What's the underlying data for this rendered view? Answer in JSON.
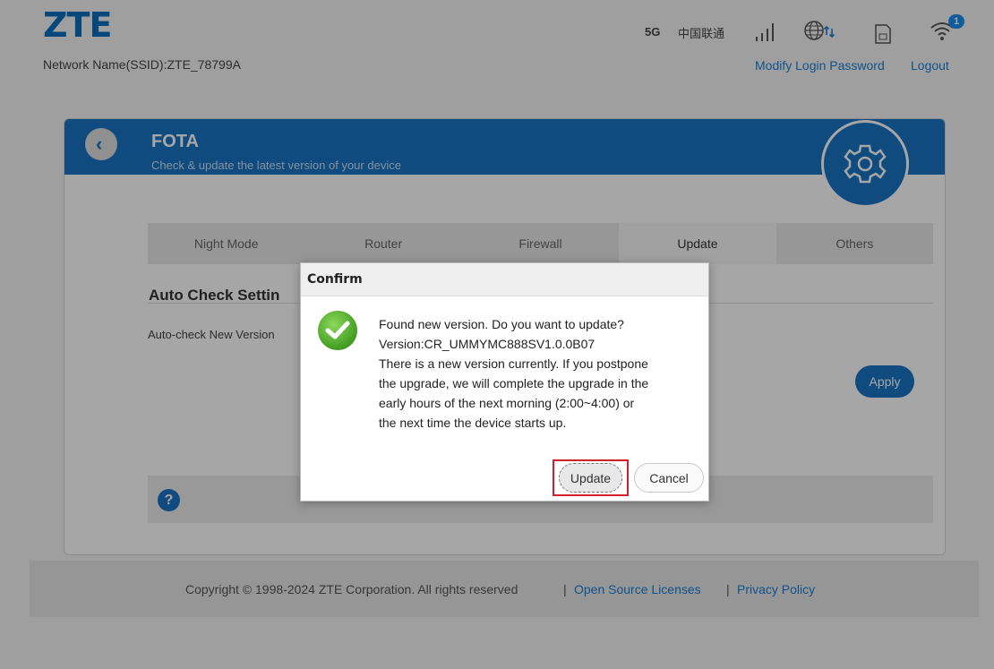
{
  "header": {
    "logo": "ZTE",
    "ssid_text": "Network Name(SSID):ZTE_78799A",
    "network_type": "5G",
    "carrier": "中国联通",
    "wifi_badge_count": "1",
    "modify_password_link": "Modify Login Password",
    "logout_link": "Logout"
  },
  "panel": {
    "title": "FOTA",
    "subtitle": "Check & update the latest version of your device",
    "tabs": [
      {
        "label": "Night Mode"
      },
      {
        "label": "Router"
      },
      {
        "label": "Firewall"
      },
      {
        "label": "Update"
      },
      {
        "label": "Others"
      }
    ],
    "active_tab": "Update",
    "section_title": "Auto Check Settin",
    "setting_label": "Auto-check New Version",
    "apply_label": "Apply",
    "help_icon": "?"
  },
  "dialog": {
    "title": "Confirm",
    "lines": [
      "Found new version. Do you want to update?",
      "Version:CR_UMMYMC888SV1.0.0B07",
      "There is a new version currently. If you postpone",
      "the upgrade, we will complete the upgrade in the",
      "early hours of the next morning (2:00~4:00) or",
      "the next time the device starts up."
    ],
    "update_label": "Update",
    "cancel_label": "Cancel"
  },
  "footer": {
    "copyright": "Copyright © 1998-2024 ZTE Corporation. All rights reserved",
    "separator": "|",
    "open_source_link": "Open Source Licenses",
    "privacy_link": "Privacy Policy"
  },
  "colors": {
    "brand_blue": "#1a74c4",
    "link_blue": "#1b7fd6",
    "highlight_red": "#d4202b",
    "success_green": "#5cb82e"
  },
  "icons": [
    "back-icon",
    "settings-gear-icon",
    "signal-icon",
    "globe-data-icon",
    "sim-card-icon",
    "wifi-icon",
    "help-icon",
    "check-icon"
  ]
}
